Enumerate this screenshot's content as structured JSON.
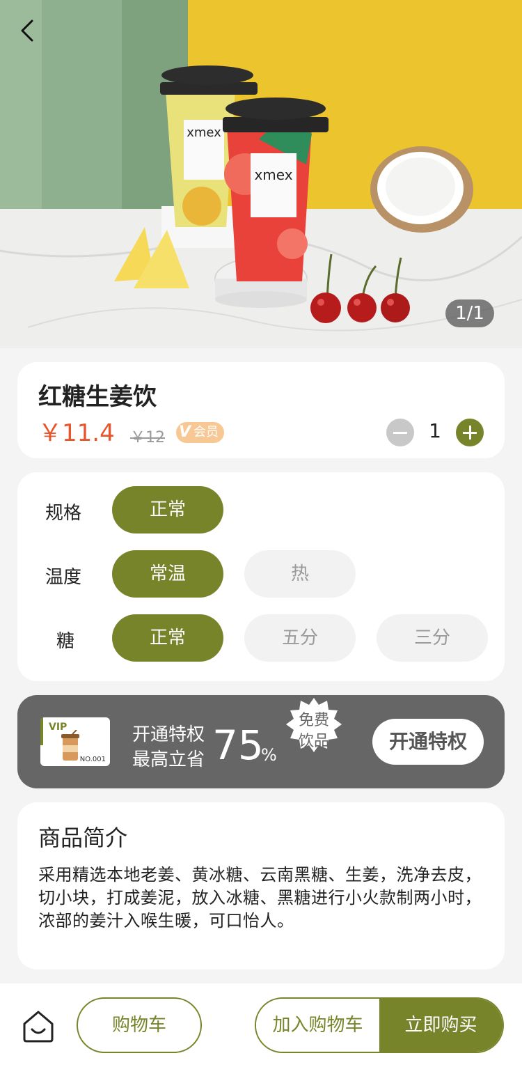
{
  "hero": {
    "image_counter": "1/1",
    "brand_text": "xmex"
  },
  "product": {
    "name": "红糖生姜饮",
    "price": "￥11.4",
    "original_price": "￥12",
    "vip_tag_letter": "V",
    "vip_tag_label": "会员",
    "quantity": "1"
  },
  "options": {
    "spec": {
      "label": "规格",
      "choices": [
        "正常"
      ],
      "selected": "正常"
    },
    "temperature": {
      "label": "温度",
      "choices": [
        "常温",
        "热"
      ],
      "selected": "常温"
    },
    "sugar": {
      "label": "糖",
      "choices": [
        "正常",
        "五分",
        "三分"
      ],
      "selected": "正常"
    }
  },
  "vip_banner": {
    "card_label": "VIP",
    "card_no": "NO.001",
    "line1": "开通特权",
    "line2": "最高立省",
    "percent": "75",
    "percent_sign": "%",
    "badge_line1": "免费",
    "badge_line2": "饮品",
    "button_label": "开通特权"
  },
  "description": {
    "title": "商品简介",
    "text": "采用精选本地老姜、黄冰糖、云南黑糖、生姜，洗净去皮，切小块，打成姜泥，放入冰糖、黑糖进行小火款制两小时，浓部的姜汁入喉生暖，可口怡人。"
  },
  "bottom_bar": {
    "cart_label": "购物车",
    "add_cart_label": "加入购物车",
    "buy_now_label": "立即购买"
  },
  "colors": {
    "accent": "#77842a",
    "price": "#e8542b",
    "vip_tag": "#f7c894",
    "banner_bg": "#666666",
    "page_bg": "#f4f4f4"
  },
  "icons": {
    "back": "chevron-left-icon",
    "home": "home-icon",
    "minus": "minus-icon",
    "plus": "plus-icon"
  }
}
